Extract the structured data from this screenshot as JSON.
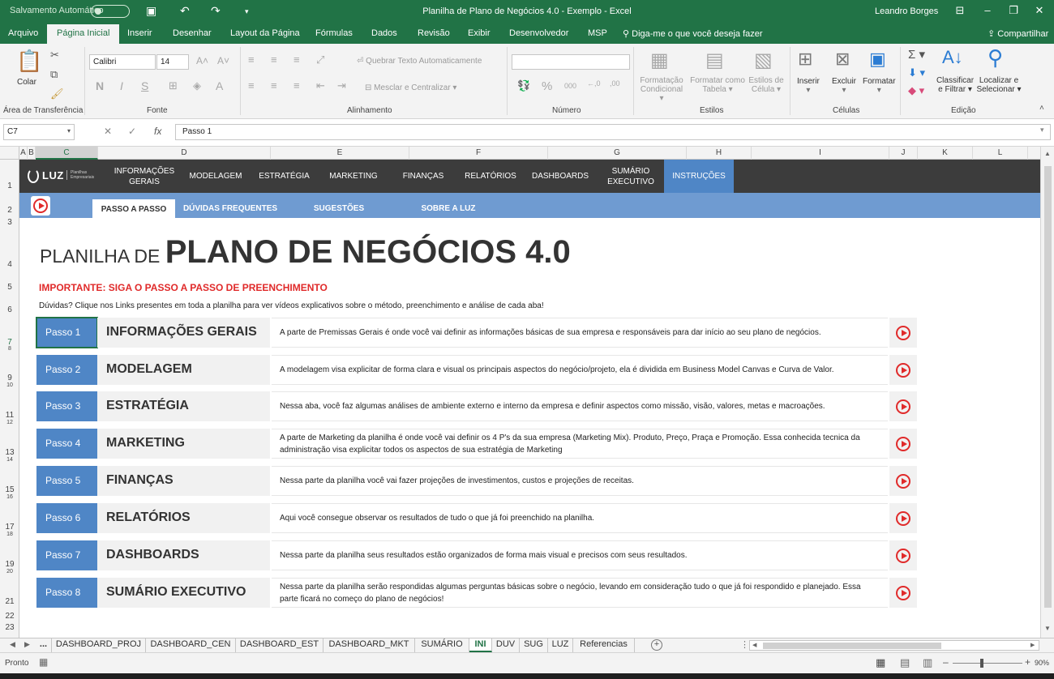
{
  "window": {
    "autosave_label": "Salvamento Automático",
    "title": "Planilha de Plano de Negócios 4.0 - Exemplo  -  Excel",
    "user": "Leandro Borges"
  },
  "ribbon_tabs": [
    "Arquivo",
    "Página Inicial",
    "Inserir",
    "Desenhar",
    "Layout da Página",
    "Fórmulas",
    "Dados",
    "Revisão",
    "Exibir",
    "Desenvolvedor",
    "MSP"
  ],
  "tellme": "Diga-me o que você deseja fazer",
  "share": "Compartilhar",
  "ribbon": {
    "paste": "Colar",
    "font_name": "Calibri",
    "font_size": "14",
    "wrap_text": "Quebrar Texto Automaticamente",
    "merge_center": "Mesclar e Centralizar",
    "cond_format": [
      "Formatação",
      "Condicional"
    ],
    "format_table": [
      "Formatar como",
      "Tabela"
    ],
    "cell_styles": [
      "Estilos de",
      "Célula"
    ],
    "insert": "Inserir",
    "delete": "Excluir",
    "format": "Formatar",
    "sort_filter": [
      "Classificar",
      "e Filtrar"
    ],
    "find_select": [
      "Localizar e",
      "Selecionar"
    ],
    "groups": [
      "Área de Transferência",
      "Fonte",
      "Alinhamento",
      "Número",
      "Estilos",
      "Células",
      "Edição"
    ]
  },
  "formula_bar": {
    "name_box": "C7",
    "formula": "Passo 1"
  },
  "columns": [
    "A",
    "B",
    "C",
    "D",
    "E",
    "F",
    "G",
    "H",
    "I",
    "J",
    "K",
    "L"
  ],
  "rows": [
    "1",
    "2",
    "3",
    "4",
    "5",
    "6",
    "7",
    "8",
    "9",
    "10",
    "11",
    "12",
    "13",
    "14",
    "15",
    "16",
    "17",
    "18",
    "19",
    "20",
    "21",
    "22",
    "23"
  ],
  "sheet": {
    "logo_word": "LUZ",
    "logo_tag": "Planilhas Empresariais",
    "nav": [
      "INFORMAÇÕES GERAIS",
      "MODELAGEM",
      "ESTRATÉGIA",
      "MARKETING",
      "FINANÇAS",
      "RELATÓRIOS",
      "DASHBOARDS",
      "SUMÁRIO EXECUTIVO",
      "INSTRUÇÕES"
    ],
    "subnav": [
      "PASSO A PASSO",
      "DÚVIDAS FREQUENTES",
      "SUGESTÕES",
      "SOBRE A LUZ"
    ],
    "title_prefix": "PLANILHA DE ",
    "title_main": "PLANO DE NEGÓCIOS 4.0",
    "important": "IMPORTANTE: SIGA O PASSO A PASSO DE PREENCHIMENTO",
    "doubts": "Dúvidas? Clique nos Links presentes em toda a planilha para ver vídeos explicativos sobre o método, preenchimento e análise de cada aba!",
    "steps": [
      {
        "badge": "Passo 1",
        "name": "INFORMAÇÕES GERAIS",
        "desc": "A parte de Premissas Gerais é onde você vai definir as informações básicas de sua empresa e responsáveis para dar início ao seu plano de negócios."
      },
      {
        "badge": "Passo 2",
        "name": "MODELAGEM",
        "desc": "A modelagem visa explicitar de forma clara e visual os principais aspectos do negócio/projeto, ela é dividida em Business Model Canvas e Curva de Valor."
      },
      {
        "badge": "Passo 3",
        "name": "ESTRATÉGIA",
        "desc": "Nessa aba, você faz algumas análises de ambiente externo e interno da empresa e definir aspectos como missão, visão, valores, metas e macroações."
      },
      {
        "badge": "Passo 4",
        "name": "MARKETING",
        "desc": "A parte de Marketing da planilha é onde você vai definir os 4 P's da sua empresa (Marketing Mix). Produto, Preço, Praça e Promoção. Essa conhecida tecnica da administração visa explicitar todos os aspectos de sua estratégia de Marketing"
      },
      {
        "badge": "Passo 5",
        "name": "FINANÇAS",
        "desc": "Nessa parte da planilha você vai fazer projeções de investimentos, custos e projeções de receitas."
      },
      {
        "badge": "Passo 6",
        "name": "RELATÓRIOS",
        "desc": "Aqui você consegue observar os resultados de tudo o que já foi preenchido na planilha."
      },
      {
        "badge": "Passo 7",
        "name": "DASHBOARDS",
        "desc": "Nessa parte da planilha seus resultados estão organizados de forma mais visual e precisos com seus resultados."
      },
      {
        "badge": "Passo 8",
        "name": "SUMÁRIO EXECUTIVO",
        "desc": "Nessa parte da planilha serão respondidas algumas perguntas básicas sobre o negócio, levando em consideração tudo o que já foi respondido e planejado. Essa parte ficará no começo do plano de negócios!"
      }
    ]
  },
  "sheet_tabs": [
    "...",
    "DASHBOARD_PROJ",
    "DASHBOARD_CEN",
    "DASHBOARD_EST",
    "DASHBOARD_MKT",
    "SUMÁRIO",
    "INI",
    "DUV",
    "SUG",
    "LUZ",
    "Referencias"
  ],
  "status": {
    "ready": "Pronto",
    "zoom": "90%"
  },
  "colors": {
    "excel_green": "#217346",
    "nav_dark": "#3c3c3c",
    "accent_blue": "#4f86c6",
    "subnav_blue": "#6f9bd1",
    "important_red": "#e02a2a"
  },
  "icons": [
    "save-icon",
    "undo-icon",
    "redo-icon",
    "paste-icon",
    "cut-icon",
    "copy-icon",
    "format-painter-icon",
    "bold-icon",
    "italic-icon",
    "underline-icon",
    "sum-icon",
    "sort-icon",
    "search-icon",
    "play-icon",
    "fx-icon"
  ]
}
